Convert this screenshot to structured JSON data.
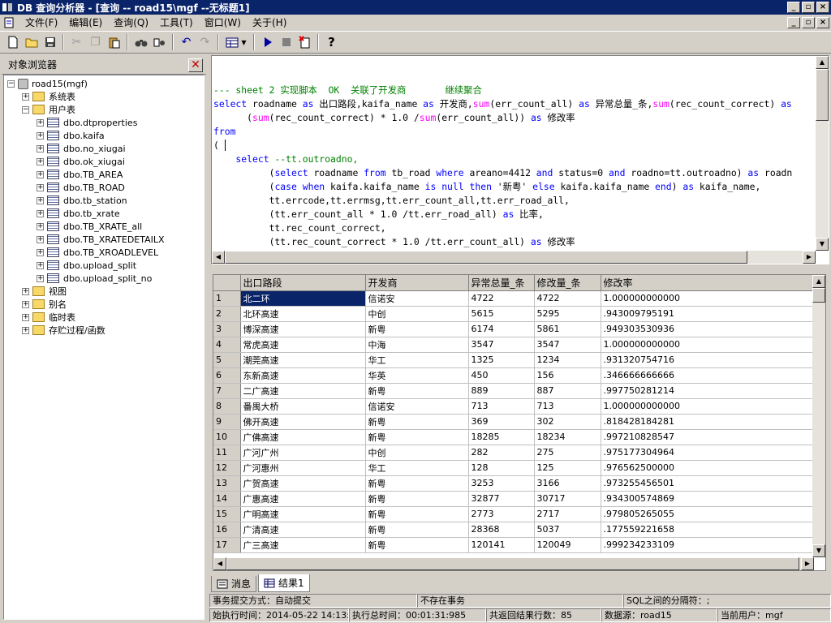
{
  "window": {
    "title": "DB 查询分析器 - [查询 -- road15\\mgf  --无标题1]"
  },
  "menu": [
    "文件(F)",
    "编辑(E)",
    "查询(Q)",
    "工具(T)",
    "窗口(W)",
    "关于(H)"
  ],
  "object_browser": {
    "title": "对象浏览器",
    "root": "road15(mgf)",
    "system_tables": "系统表",
    "user_tables": "用户表",
    "tables": [
      "dbo.dtproperties",
      "dbo.kaifa",
      "dbo.no_xiugai",
      "dbo.ok_xiugai",
      "dbo.TB_AREA",
      "dbo.TB_ROAD",
      "dbo.tb_station",
      "dbo.tb_xrate",
      "dbo.TB_XRATE_all",
      "dbo.TB_XRATEDETAILX",
      "dbo.TB_XROADLEVEL",
      "dbo.upload_split",
      "dbo.upload_split_no"
    ],
    "views": "视图",
    "aliases": "别名",
    "temp_tables": "临时表",
    "procedures": "存贮过程/函数"
  },
  "editor": {
    "l1": "--- sheet 2 实现脚本  OK  关联了开发商       继续聚合",
    "l2a": "select",
    " l2b": " roadname ",
    "l2c": "as",
    " l2d": " 出口路段,kaifa_name ",
    "l2e": "as",
    " l2f": " 开发商,",
    "l2g": "sum",
    "l2h": "(err_count_all) ",
    "l2i": "as",
    " l2j": " 异常总量_条,",
    "l2k": "sum",
    "l2l": "(rec_count_correct) ",
    "l2m": "as",
    "l3a": "      (",
    "l3b": "sum",
    "l3c": "(rec_count_correct) * 1.0 /",
    "l3d": "sum",
    "l3e": "(err_count_all)) ",
    "l3f": "as",
    " l3g": " 修改率",
    "l4": "from",
    "l5": "( ",
    "l6a": "    select",
    " l6b": " --tt.outroadno,",
    "l7a": "          (",
    "l7b": "select",
    " l7c": " roadname ",
    "l7d": "from",
    " l7e": " tb_road ",
    "l7f": "where",
    " l7g": " areano=4412 ",
    "l7h": "and",
    " l7i": " status=0 ",
    "l7j": "and",
    " l7k": " roadno=tt.outroadno) ",
    "l7l": "as",
    " l7m": " roadn",
    "l8a": "          (",
    "l8b": "case",
    " l8c": " ",
    "l8d": "when",
    " l8e": " kaifa.kaifa_name ",
    "l8f": "is",
    " l8g": " ",
    "l8h": "null",
    " l8i": " ",
    "l8j": "then",
    " l8k": " ",
    "l8l": "'新粤'",
    " l8m": " ",
    "l8n": "else",
    " l8o": " kaifa.kaifa_name ",
    "l8p": "end",
    " l8q": ") ",
    "l8r": "as",
    " l8s": " kaifa_name,",
    "l9": "          tt.errcode,tt.errmsg,tt.err_count_all,tt.err_road_all,",
    "l10a": "          (tt.err_count_all * 1.0 /tt.err_road_all) ",
    "l10b": "as",
    " l10c": " 比率,",
    "l11": "          tt.rec_count_correct,",
    "l12a": "          (tt.rec_count_correct * 1.0 /tt.err_count_all) ",
    "l12b": "as",
    " l12c": " 修改率"
  },
  "grid": {
    "headers": [
      "出口路段",
      "开发商",
      "异常总量_条",
      "修改量_条",
      "修改率"
    ],
    "rows": [
      [
        "1",
        "北二环",
        "信诺安",
        "4722",
        "4722",
        "1.000000000000"
      ],
      [
        "2",
        "北环高速",
        "中创",
        "5615",
        "5295",
        ".943009795191"
      ],
      [
        "3",
        "博深高速",
        "新粤",
        "6174",
        "5861",
        ".949303530936"
      ],
      [
        "4",
        "常虎高速",
        "中海",
        "3547",
        "3547",
        "1.000000000000"
      ],
      [
        "5",
        "潮莞高速",
        "华工",
        "1325",
        "1234",
        ".931320754716"
      ],
      [
        "6",
        "东新高速",
        "华英",
        "450",
        "156",
        ".346666666666"
      ],
      [
        "7",
        "二广高速",
        "新粤",
        "889",
        "887",
        ".997750281214"
      ],
      [
        "8",
        "番禺大桥",
        "信诺安",
        "713",
        "713",
        "1.000000000000"
      ],
      [
        "9",
        "佛开高速",
        "新粤",
        "369",
        "302",
        ".818428184281"
      ],
      [
        "10",
        "广佛高速",
        "新粤",
        "18285",
        "18234",
        ".997210828547"
      ],
      [
        "11",
        "广河广州",
        "中创",
        "282",
        "275",
        ".975177304964"
      ],
      [
        "12",
        "广河惠州",
        "华工",
        "128",
        "125",
        ".976562500000"
      ],
      [
        "13",
        "广贺高速",
        "新粤",
        "3253",
        "3166",
        ".973255456501"
      ],
      [
        "14",
        "广惠高速",
        "新粤",
        "32877",
        "30717",
        ".934300574869"
      ],
      [
        "15",
        "广明高速",
        "新粤",
        "2773",
        "2717",
        ".979805265055"
      ],
      [
        "16",
        "广清高速",
        "新粤",
        "28368",
        "5037",
        ".177559221658"
      ],
      [
        "17",
        "广三高速",
        "新粤",
        "120141",
        "120049",
        ".999234233109"
      ]
    ]
  },
  "tabs": {
    "messages": "消息",
    "results": "结果1"
  },
  "status": {
    "commit_mode": "事务提交方式：自动提交",
    "transaction": "不存在事务",
    "separator": "SQL之间的分隔符：;",
    "start_time": "始执行时间：2014-05-22 14:13:",
    "total_time": "执行总时间：00:01:31:985",
    "rows": "共返回结果行数：85",
    "datasource": "数据源：road15",
    "user": "当前用户：mgf"
  }
}
